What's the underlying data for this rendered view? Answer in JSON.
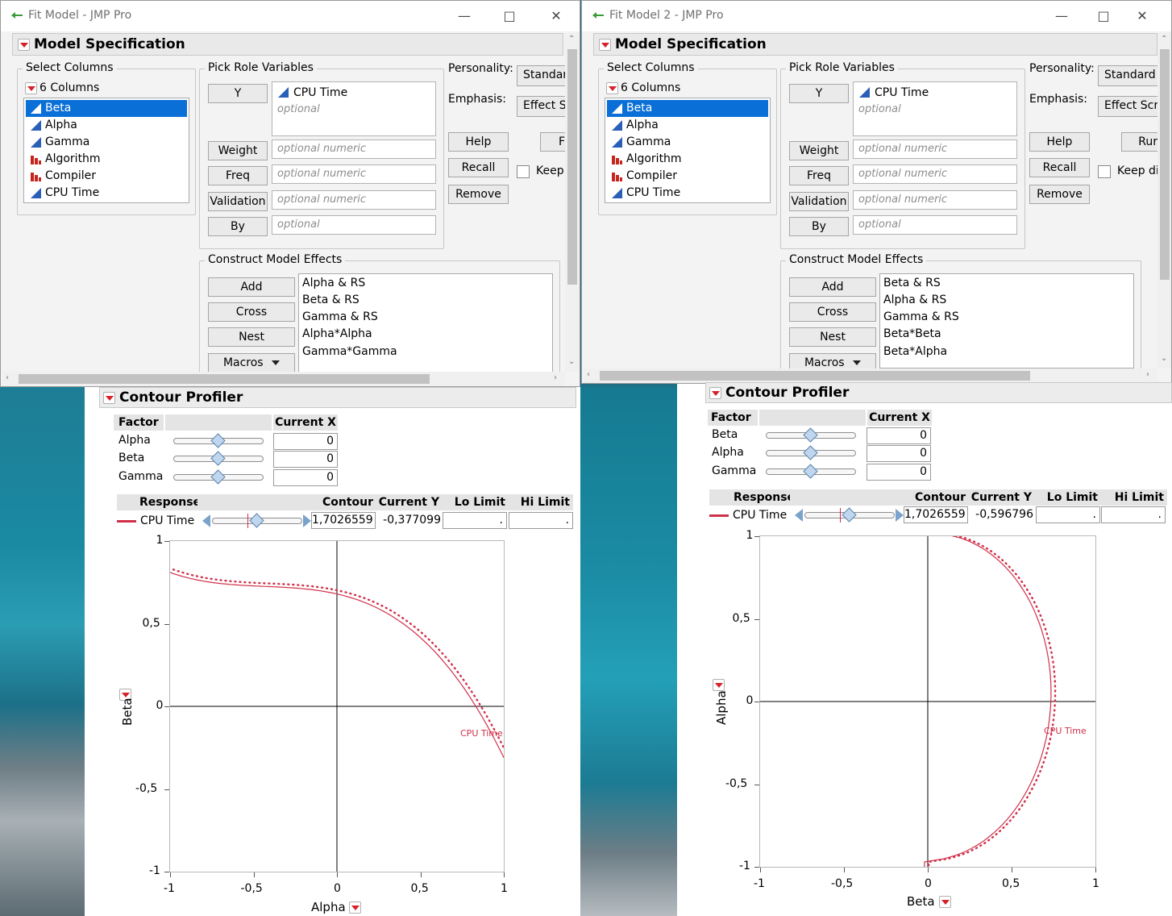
{
  "left": {
    "window": {
      "title": "Fit Model - JMP Pro",
      "outline_title": "Model Specification",
      "select_columns": {
        "label": "Select Columns",
        "count_label": "6 Columns",
        "columns": [
          {
            "name": "Beta",
            "icon": "continuous-icon"
          },
          {
            "name": "Alpha",
            "icon": "continuous-icon"
          },
          {
            "name": "Gamma",
            "icon": "continuous-icon"
          },
          {
            "name": "Algorithm",
            "icon": "nominal-icon"
          },
          {
            "name": "Compiler",
            "icon": "nominal-icon"
          },
          {
            "name": "CPU Time",
            "icon": "continuous-icon"
          }
        ],
        "selected": "Beta"
      },
      "pick_role": {
        "label": "Pick Role Variables",
        "y_button": "Y",
        "y_value": "CPU Time",
        "y_placeholder": "optional",
        "weight_button": "Weight",
        "weight_placeholder": "optional numeric",
        "freq_button": "Freq",
        "freq_placeholder": "optional numeric",
        "validation_button": "Validation",
        "validation_placeholder": "optional numeric",
        "by_button": "By",
        "by_placeholder": "optional"
      },
      "personality_label": "Personality:",
      "personality_value": "Standar",
      "emphasis_label": "Emphasis:",
      "emphasis_value": "Effect S",
      "help_button": "Help",
      "run_button": "F",
      "recall_button": "Recall",
      "keep_label": "Keep",
      "remove_button": "Remove",
      "construct": {
        "label": "Construct Model Effects",
        "add_button": "Add",
        "cross_button": "Cross",
        "nest_button": "Nest",
        "macros_button": "Macros",
        "effects": [
          "Alpha & RS",
          "Beta & RS",
          "Gamma & RS",
          "Alpha*Alpha",
          "Gamma*Gamma"
        ]
      }
    },
    "profiler": {
      "title": "Contour Profiler",
      "factor_header": "Factor",
      "current_x_header": "Current X",
      "factors": [
        {
          "name": "Alpha",
          "value": "0",
          "position": 0.5
        },
        {
          "name": "Beta",
          "value": "0",
          "position": 0.5
        },
        {
          "name": "Gamma",
          "value": "0",
          "position": 0.5
        }
      ],
      "response_header": "Response",
      "contour_header": "Contour",
      "current_y_header": "Current Y",
      "lo_header": "Lo Limit",
      "hi_header": "Hi Limit",
      "response": {
        "name": "CPU Time",
        "contour": "1,7026559",
        "current_y": "-0,377099",
        "lo": ".",
        "hi": "."
      },
      "curve_label": "CPU Time",
      "x_axis_label": "Alpha",
      "y_axis_label": "Beta",
      "x_ticks": [
        "-1",
        "-0,5",
        "0",
        "0,5",
        "1"
      ],
      "y_ticks": [
        "1",
        "0,5",
        "0",
        "-0,5",
        "-1"
      ]
    }
  },
  "right": {
    "window": {
      "title": "Fit Model 2 - JMP Pro",
      "outline_title": "Model Specification",
      "select_columns": {
        "label": "Select Columns",
        "count_label": "6 Columns",
        "columns": [
          {
            "name": "Beta",
            "icon": "continuous-icon"
          },
          {
            "name": "Alpha",
            "icon": "continuous-icon"
          },
          {
            "name": "Gamma",
            "icon": "continuous-icon"
          },
          {
            "name": "Algorithm",
            "icon": "nominal-icon"
          },
          {
            "name": "Compiler",
            "icon": "nominal-icon"
          },
          {
            "name": "CPU Time",
            "icon": "continuous-icon"
          }
        ],
        "selected": "Beta"
      },
      "pick_role": {
        "label": "Pick Role Variables",
        "y_button": "Y",
        "y_value": "CPU Time",
        "y_placeholder": "optional",
        "weight_button": "Weight",
        "weight_placeholder": "optional numeric",
        "freq_button": "Freq",
        "freq_placeholder": "optional numeric",
        "validation_button": "Validation",
        "validation_placeholder": "optional numeric",
        "by_button": "By",
        "by_placeholder": "optional"
      },
      "personality_label": "Personality:",
      "personality_value": "Standard I",
      "emphasis_label": "Emphasis:",
      "emphasis_value": "Effect Scre",
      "help_button": "Help",
      "run_button": "Rur",
      "recall_button": "Recall",
      "keep_label": "Keep di",
      "remove_button": "Remove",
      "construct": {
        "label": "Construct Model Effects",
        "add_button": "Add",
        "cross_button": "Cross",
        "nest_button": "Nest",
        "macros_button": "Macros",
        "effects": [
          "Beta & RS",
          "Alpha & RS",
          "Gamma & RS",
          "Beta*Beta",
          "Beta*Alpha"
        ]
      }
    },
    "profiler": {
      "title": "Contour Profiler",
      "factor_header": "Factor",
      "current_x_header": "Current X",
      "factors": [
        {
          "name": "Beta",
          "value": "0",
          "position": 0.5
        },
        {
          "name": "Alpha",
          "value": "0",
          "position": 0.5
        },
        {
          "name": "Gamma",
          "value": "0",
          "position": 0.5
        }
      ],
      "response_header": "Response",
      "contour_header": "Contour",
      "current_y_header": "Current Y",
      "lo_header": "Lo Limit",
      "hi_header": "Hi Limit",
      "response": {
        "name": "CPU Time",
        "contour": "1,7026559",
        "current_y": "-0,596796",
        "lo": ".",
        "hi": "."
      },
      "curve_label": "CPU Time",
      "x_axis_label": "Beta",
      "y_axis_label": "Alpha",
      "x_ticks": [
        "-1",
        "-0,5",
        "0",
        "0,5",
        "1"
      ],
      "y_ticks": [
        "1",
        "0,5",
        "0",
        "-0,5",
        "-1"
      ]
    }
  },
  "colors": {
    "selection": "#0a6fd6",
    "contour": "#d0304a",
    "accent_red": "#d8202a"
  }
}
